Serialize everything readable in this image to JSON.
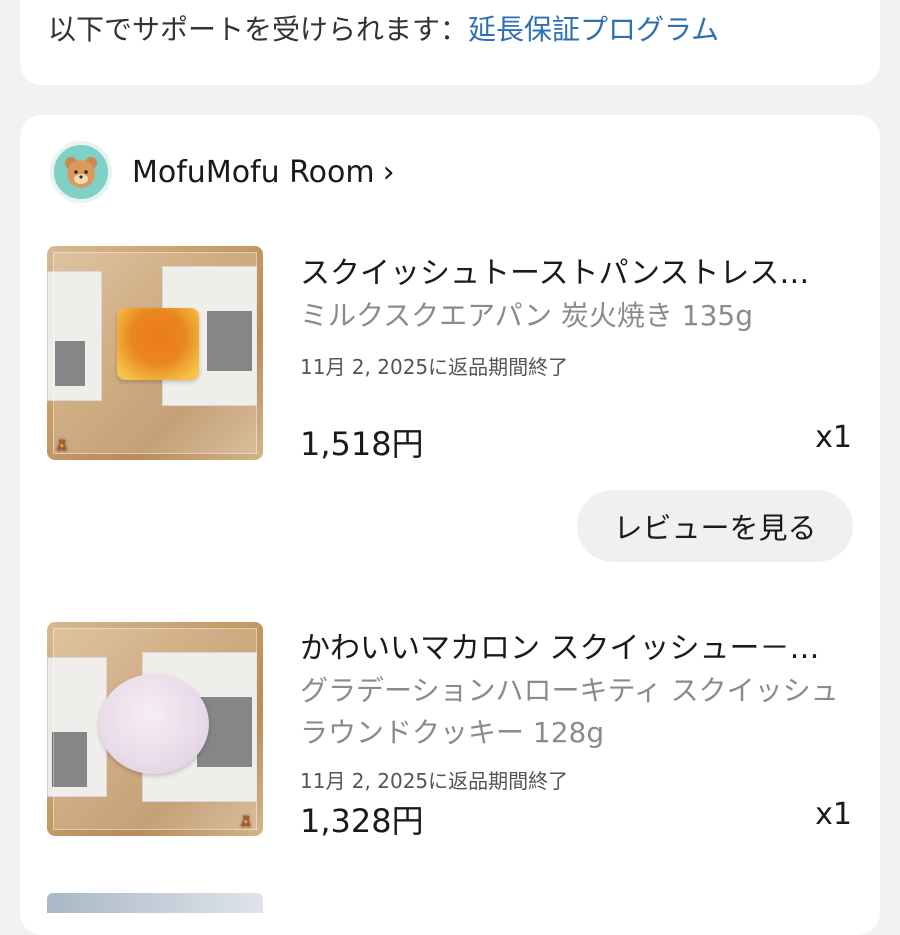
{
  "warranty": {
    "prefix": "以下でサポートを受けられます：",
    "link": "延長保証プログラム"
  },
  "shop": {
    "name": "MofuMofu Room",
    "chevron": "›",
    "logo_icon": "bear-logo-icon"
  },
  "items": [
    {
      "title": "スクイッシュトーストパンストレス…",
      "variant": "ミルクスクエアパン 炭火焼き 135g",
      "return_note": "11月 2, 2025に返品期間終了",
      "price": "1,518円",
      "qty": "x1",
      "review_label": "レビューを見る"
    },
    {
      "title": "かわいいマカロン スクイッシュー－…",
      "variant": "グラデーションハローキティ スクイッシュラウンドクッキー 128g",
      "return_note": "11月 2, 2025に返品期間終了",
      "price": "1,328円",
      "qty": "x1"
    }
  ],
  "colors": {
    "link": "#2f6fb4",
    "background": "#f2f2f4",
    "card": "#ffffff",
    "muted_text": "#8b8b8f"
  }
}
